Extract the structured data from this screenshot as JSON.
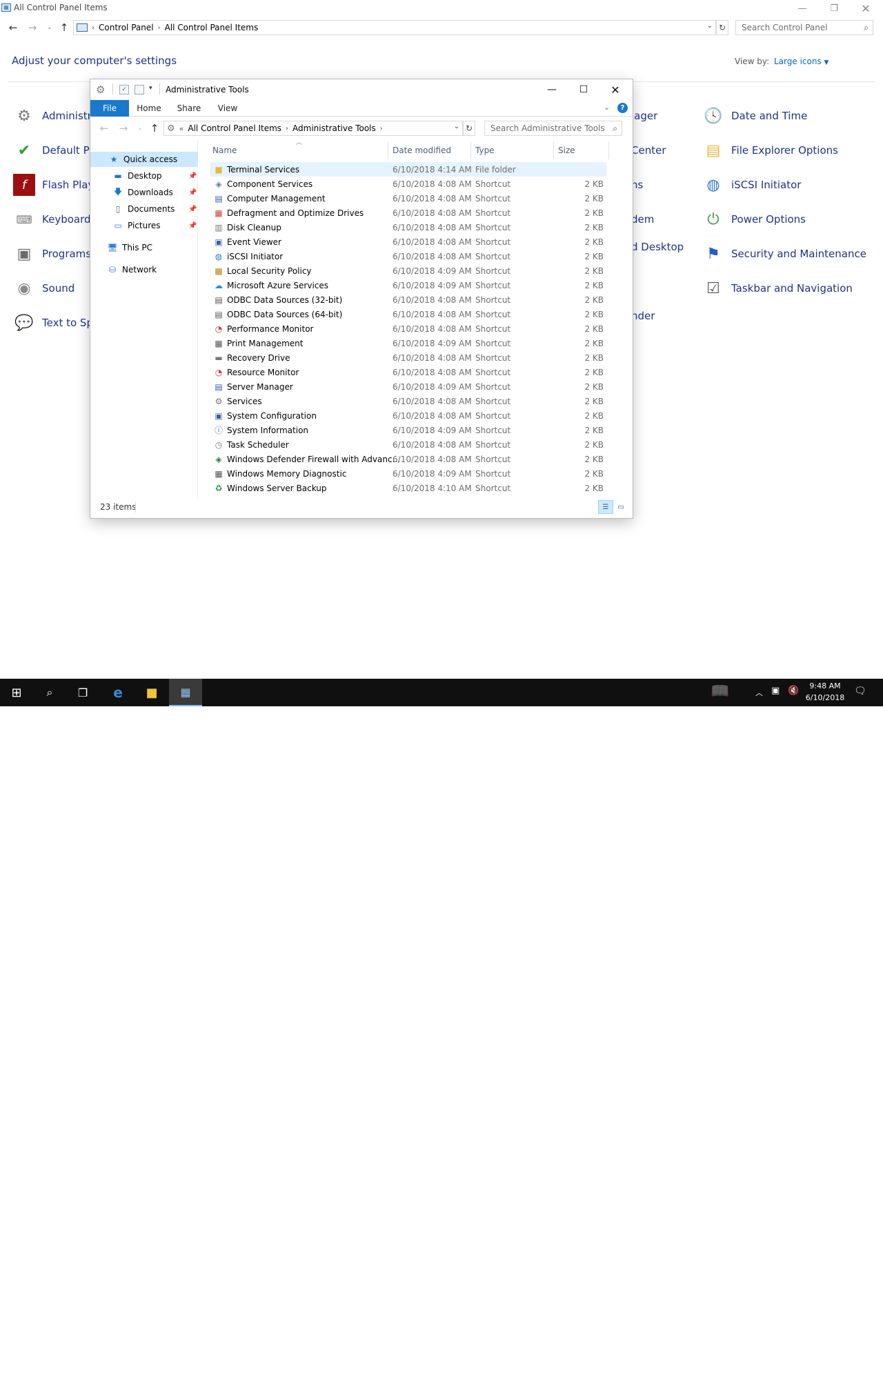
{
  "control_panel": {
    "window_title": "All Control Panel Items",
    "breadcrumbs": [
      "Control Panel",
      "All Control Panel Items"
    ],
    "search_placeholder": "Search Control Panel",
    "heading": "Adjust your computer's settings",
    "view_by_label": "View by:",
    "view_by_value": "Large icons",
    "left_items": [
      {
        "label": "Administr",
        "icon": "admin-tools-icon"
      },
      {
        "label": "Default Pr",
        "icon": "default-programs-icon"
      },
      {
        "label": "Flash Play",
        "icon": "flash-player-icon"
      },
      {
        "label": "Keyboard",
        "icon": "keyboard-icon"
      },
      {
        "label": "Programs",
        "icon": "programs-icon"
      },
      {
        "label": "Sound",
        "icon": "sound-icon"
      },
      {
        "label": "Text to Sp",
        "icon": "speech-icon"
      }
    ],
    "middle_fragments": [
      "iager",
      "Center",
      "ns",
      "dem",
      "d Desktop",
      "nder"
    ],
    "right_items": [
      {
        "label": "Date and Time",
        "icon": "clock-icon"
      },
      {
        "label": "File Explorer Options",
        "icon": "folder-options-icon"
      },
      {
        "label": "iSCSI Initiator",
        "icon": "globe-icon"
      },
      {
        "label": "Power Options",
        "icon": "power-icon"
      },
      {
        "label": "Security and Maintenance",
        "icon": "flag-icon"
      },
      {
        "label": "Taskbar and Navigation",
        "icon": "taskbar-icon"
      }
    ]
  },
  "admin_tools": {
    "title": "Administrative Tools",
    "ribbon_tabs": [
      "File",
      "Home",
      "Share",
      "View"
    ],
    "breadcrumbs": [
      "All Control Panel Items",
      "Administrative Tools"
    ],
    "search_placeholder": "Search Administrative Tools",
    "nav": {
      "quick_access": "Quick access",
      "desktop": "Desktop",
      "downloads": "Downloads",
      "documents": "Documents",
      "pictures": "Pictures",
      "this_pc": "This PC",
      "network": "Network"
    },
    "columns": {
      "name": "Name",
      "date": "Date modified",
      "type": "Type",
      "size": "Size"
    },
    "files": [
      {
        "name": "Terminal Services",
        "date": "6/10/2018 4:14 AM",
        "type": "File folder",
        "size": ""
      },
      {
        "name": "Component Services",
        "date": "6/10/2018 4:08 AM",
        "type": "Shortcut",
        "size": "2 KB"
      },
      {
        "name": "Computer Management",
        "date": "6/10/2018 4:08 AM",
        "type": "Shortcut",
        "size": "2 KB"
      },
      {
        "name": "Defragment and Optimize Drives",
        "date": "6/10/2018 4:08 AM",
        "type": "Shortcut",
        "size": "2 KB"
      },
      {
        "name": "Disk Cleanup",
        "date": "6/10/2018 4:08 AM",
        "type": "Shortcut",
        "size": "2 KB"
      },
      {
        "name": "Event Viewer",
        "date": "6/10/2018 4:08 AM",
        "type": "Shortcut",
        "size": "2 KB"
      },
      {
        "name": "iSCSI Initiator",
        "date": "6/10/2018 4:08 AM",
        "type": "Shortcut",
        "size": "2 KB"
      },
      {
        "name": "Local Security Policy",
        "date": "6/10/2018 4:09 AM",
        "type": "Shortcut",
        "size": "2 KB"
      },
      {
        "name": "Microsoft Azure Services",
        "date": "6/10/2018 4:09 AM",
        "type": "Shortcut",
        "size": "2 KB"
      },
      {
        "name": "ODBC Data Sources (32-bit)",
        "date": "6/10/2018 4:08 AM",
        "type": "Shortcut",
        "size": "2 KB"
      },
      {
        "name": "ODBC Data Sources (64-bit)",
        "date": "6/10/2018 4:08 AM",
        "type": "Shortcut",
        "size": "2 KB"
      },
      {
        "name": "Performance Monitor",
        "date": "6/10/2018 4:08 AM",
        "type": "Shortcut",
        "size": "2 KB"
      },
      {
        "name": "Print Management",
        "date": "6/10/2018 4:09 AM",
        "type": "Shortcut",
        "size": "2 KB"
      },
      {
        "name": "Recovery Drive",
        "date": "6/10/2018 4:08 AM",
        "type": "Shortcut",
        "size": "2 KB"
      },
      {
        "name": "Resource Monitor",
        "date": "6/10/2018 4:08 AM",
        "type": "Shortcut",
        "size": "2 KB"
      },
      {
        "name": "Server Manager",
        "date": "6/10/2018 4:09 AM",
        "type": "Shortcut",
        "size": "2 KB"
      },
      {
        "name": "Services",
        "date": "6/10/2018 4:08 AM",
        "type": "Shortcut",
        "size": "2 KB"
      },
      {
        "name": "System Configuration",
        "date": "6/10/2018 4:08 AM",
        "type": "Shortcut",
        "size": "2 KB"
      },
      {
        "name": "System Information",
        "date": "6/10/2018 4:09 AM",
        "type": "Shortcut",
        "size": "2 KB"
      },
      {
        "name": "Task Scheduler",
        "date": "6/10/2018 4:08 AM",
        "type": "Shortcut",
        "size": "2 KB"
      },
      {
        "name": "Windows Defender Firewall with Advanc...",
        "date": "6/10/2018 4:08 AM",
        "type": "Shortcut",
        "size": "2 KB"
      },
      {
        "name": "Windows Memory Diagnostic",
        "date": "6/10/2018 4:09 AM",
        "type": "Shortcut",
        "size": "2 KB"
      },
      {
        "name": "Windows Server Backup",
        "date": "6/10/2018 4:10 AM",
        "type": "Shortcut",
        "size": "2 KB"
      }
    ],
    "status": "23 items"
  },
  "taskbar": {
    "clock_time": "9:48 AM",
    "clock_date": "6/10/2018",
    "watermark": "TheCollectionBook"
  },
  "colors": {
    "link_blue": "#1e3287",
    "accent": "#1979ca",
    "selection": "#cce8ff",
    "taskbar": "#101010"
  }
}
